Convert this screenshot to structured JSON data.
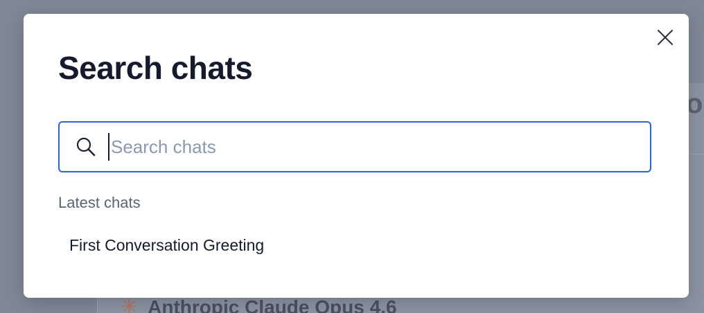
{
  "background": {
    "heading_fragment": "o",
    "model_label": "Anthropic Claude Opus 4.6",
    "model_icon": "sparkle-icon"
  },
  "modal": {
    "title": "Search chats",
    "close_icon": "close-icon",
    "search": {
      "icon": "search-icon",
      "placeholder": "Search chats",
      "value": ""
    },
    "section_label": "Latest chats",
    "chats": [
      {
        "label": "First Conversation Greeting"
      }
    ]
  },
  "colors": {
    "accent": "#2d64d8",
    "title": "#151b2c",
    "placeholder": "#8a98b2",
    "muted_label": "#5a6478",
    "backdrop": "#7f8797"
  }
}
